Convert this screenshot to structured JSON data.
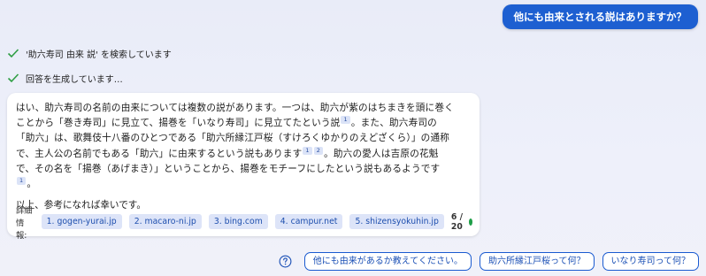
{
  "user_message": "他にも由来とされる説はありますか？",
  "status": [
    {
      "text": "'助六寿司 由来 説' を検索しています"
    },
    {
      "text": "回答を生成しています…"
    }
  ],
  "answer": {
    "lines": [
      [
        "はい、助六寿司の名前の由来については複数の説があります。一つは、助六が紫のはちまきを頭に巻く"
      ],
      [
        "ことから「巻き寿司」に見立て、揚巻を「いなり寿司」に見立てたという説",
        "1",
        "。また、助六寿司の"
      ],
      [
        "「助六」は、歌舞伎十八番のひとつである「助六所縁江戸桜（すけろくゆかりのえどざくら）」の通称"
      ],
      [
        "で、主人公の名前でもある「助六」に由来するという説もあります",
        "1",
        "2",
        "。助六の愛人は吉原の花魁"
      ],
      [
        "で、その名を「揚巻（あげまき）」ということから、揚巻をモチーフにしたという説もあるようです"
      ],
      [
        "1",
        "。"
      ]
    ],
    "closing": "以上、参考になれば幸いです。"
  },
  "footer": {
    "label": "詳細情報:",
    "references": [
      "1. gogen-yurai.jp",
      "2. macaro-ni.jp",
      "3. bing.com",
      "4. campur.net",
      "5. shizensyokuhin.jp"
    ],
    "page_count": "6 / 20"
  },
  "suggestions": [
    "他にも由来があるか教えてください。",
    "助六所縁江戸桜って何？",
    "いなり寿司って何？"
  ],
  "icons": {
    "status": "checkmark-icon",
    "help": "question-circle-icon",
    "status_dot": "green-dot"
  },
  "colors": {
    "accent": "#1d5fd1",
    "check": "#2f9e44",
    "dot": "#1f9e48",
    "chip": "#dde4f8"
  }
}
